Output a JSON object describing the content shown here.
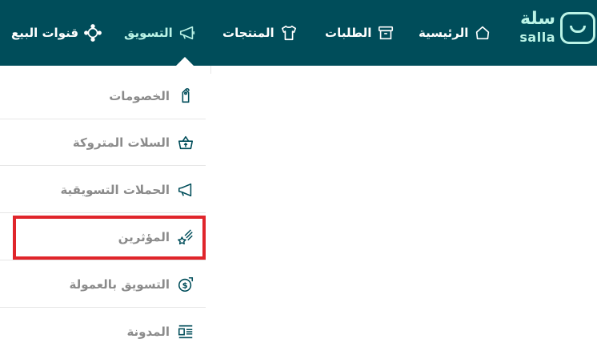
{
  "brand": {
    "name_ar": "سلة",
    "name_en": "salla"
  },
  "nav": {
    "items": [
      {
        "label": "الرئيسية",
        "icon": "home-icon"
      },
      {
        "label": "الطلبات",
        "icon": "archive-box-icon"
      },
      {
        "label": "المنتجات",
        "icon": "shirt-icon"
      },
      {
        "label": "التسويق",
        "icon": "megaphone-icon",
        "active": true
      },
      {
        "label": "قنوات البيع",
        "icon": "sales-channels-icon"
      }
    ]
  },
  "marketing_menu": {
    "items": [
      {
        "label": "الخصومات",
        "icon": "discount-tag-icon"
      },
      {
        "label": "السلات المتروكة",
        "icon": "abandoned-cart-icon"
      },
      {
        "label": "الحملات التسويقية",
        "icon": "megaphone-icon"
      },
      {
        "label": "المؤثرين",
        "icon": "shooting-star-icon",
        "highlighted": true
      },
      {
        "label": "التسويق بالعمولة",
        "icon": "affiliate-money-icon"
      },
      {
        "label": "المدونة",
        "icon": "blog-icon"
      }
    ]
  },
  "colors": {
    "topbar": "#004d5a",
    "accent": "#baf3e6",
    "menu_text": "#8b8b8b",
    "highlight": "#e0252b"
  }
}
